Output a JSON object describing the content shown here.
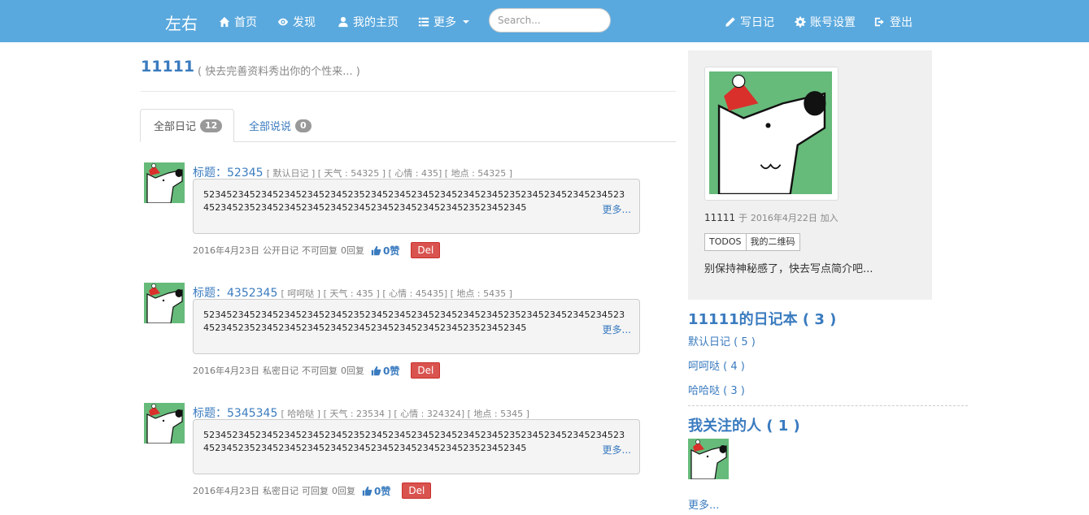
{
  "nav": {
    "brand": "左右",
    "home": "首页",
    "discover": "发现",
    "my_home": "我的主页",
    "more": "更多",
    "search_placeholder": "Search...",
    "write": "写日记",
    "settings": "账号设置",
    "logout": "登出"
  },
  "profile": {
    "username": "11111",
    "subtitle": "( 快去完善资料秀出你的个性来... )"
  },
  "tabs": [
    {
      "label": "全部日记",
      "count": "12"
    },
    {
      "label": "全部说说",
      "count": "0"
    }
  ],
  "entries": [
    {
      "title_prefix": "标题：",
      "title": "52345",
      "meta": "[ 默认日记 ] [ 天气 : 54325 ] [ 心情 : 435] [ 地点 : 54325 ]",
      "content": "523452345234523452345234523523452345234523452345234523523452345234523452345234523523452345234523452345234523452345234523523452345",
      "more": "更多...",
      "date": "2016年4月23日",
      "visibility": "公开日记",
      "reply_setting": "不可回复",
      "replies": "0回复",
      "likes": "0赞",
      "del": "Del"
    },
    {
      "title_prefix": "标题：",
      "title": "4352345",
      "meta": "[ 呵呵哒 ] [ 天气 : 435 ] [ 心情 : 45435] [ 地点 : 5435 ]",
      "content": "523452345234523452345234523523452345234523452345234523523452345234523452345234523523452345234523452345234523452345234523523452345",
      "more": "更多...",
      "date": "2016年4月23日",
      "visibility": "私密日记",
      "reply_setting": "不可回复",
      "replies": "0回复",
      "likes": "0赞",
      "del": "Del"
    },
    {
      "title_prefix": "标题：",
      "title": "5345345",
      "meta": "[ 哈哈哒 ] [ 天气 : 23534 ] [ 心情 : 324324] [ 地点 : 5345 ]",
      "content": "523452345234523452345234523523452345234523452345234523523452345234523452345234523523452345234523452345234523452345234523523452345",
      "more": "更多...",
      "date": "2016年4月23日",
      "visibility": "私密日记",
      "reply_setting": "可回复",
      "replies": "0回复",
      "likes": "0赞",
      "del": "Del"
    }
  ],
  "sidebar": {
    "joined_name": "11111",
    "joined_mid": "于",
    "joined_date": "2016年4月22日",
    "joined_suffix": "加入",
    "btn_todos": "TODOS",
    "btn_qrcode": "我的二维码",
    "bio": "别保持神秘感了，快去写点简介吧...",
    "notebooks_title": "11111的日记本 ( 3 )",
    "notebooks": [
      "默认日记 ( 5 )",
      "呵呵哒 ( 4 )",
      "哈哈哒 ( 3 )"
    ],
    "following_title": "我关注的人 ( 1 )",
    "more": "更多..."
  },
  "colors": {
    "navbar": "#5aa9de",
    "link": "#3a7bbf",
    "danger": "#d9534f",
    "avatar_bg": "#66bb7a"
  }
}
